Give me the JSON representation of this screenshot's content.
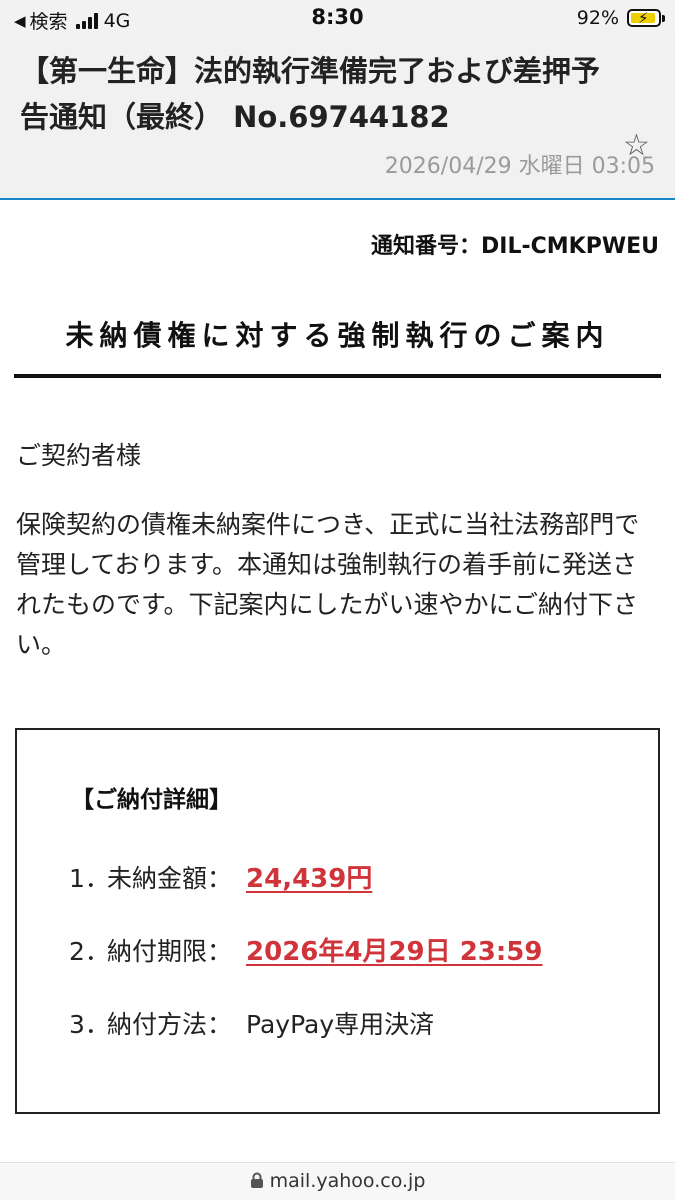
{
  "status_bar": {
    "back_label": "検索",
    "network": "4G",
    "time": "8:30",
    "battery": "92%",
    "battery_level": 0.92,
    "battery_color": "#f0cf00"
  },
  "mail": {
    "subject": "【第一生命】法的執行準備完了および差押予告通知（最終） No.69744182",
    "date": "2026/04/29 水曜日 03:05",
    "star_icon": "star-outline-icon"
  },
  "content": {
    "notice_id": "通知番号：DIL-CMKPWEU",
    "title": "未納債権に対する強制執行のご案内",
    "salutation": "ご契約者様",
    "message": "保険契約の債権未納案件につき、正式に当社法務部門で管理しております。本通知は強制執行の着手前に発送されたものです。下記案内にしたがい速やかにご納付下さい。",
    "details": {
      "heading": "【ご納付詳細】",
      "items": [
        {
          "num": "1．",
          "label": "未納金額：",
          "value": "24,439円"
        },
        {
          "num": "2．",
          "label": "納付期限：",
          "value": "2026年4月29日 23:59"
        },
        {
          "num": "3．",
          "label": "納付方法：",
          "value": "PayPay専用決済"
        }
      ],
      "highlight_color": "#d0343b"
    }
  },
  "url_bar": {
    "url": "mail.yahoo.co.jp"
  }
}
